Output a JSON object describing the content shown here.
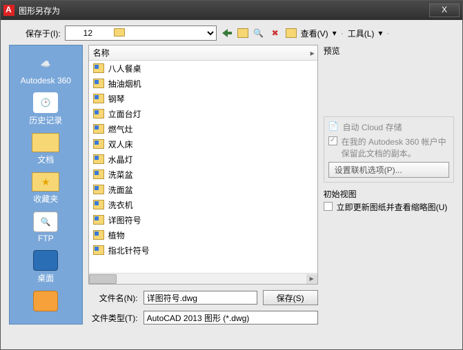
{
  "title": "图形另存为",
  "close_glyph": "X",
  "toprow": {
    "label": "保存于(I):",
    "folder": "12",
    "view_label": "查看(V)",
    "tools_label": "工具(L)"
  },
  "sidebar": [
    {
      "key": "autodesk360",
      "label": "Autodesk 360"
    },
    {
      "key": "history",
      "label": "历史记录"
    },
    {
      "key": "docs",
      "label": "文档"
    },
    {
      "key": "favorites",
      "label": "收藏夹"
    },
    {
      "key": "ftp",
      "label": "FTP"
    },
    {
      "key": "desktop",
      "label": "桌面"
    }
  ],
  "list": {
    "header_name": "名称",
    "files": [
      "八人餐桌",
      "抽油烟机",
      "钢琴",
      "立面台灯",
      "燃气灶",
      "双人床",
      "水晶灯",
      "洗菜盆",
      "洗面盆",
      "洗衣机",
      "详图符号",
      "植物",
      "指北针符号"
    ]
  },
  "right": {
    "preview_title": "预览",
    "cloud_auto": "自动 Cloud 存储",
    "cloud_keep": "在我的 Autodesk 360 帐户中保留此文档的副本。",
    "online_btn": "设置联机选项(P)...",
    "initview_title": "初始视图",
    "initview_chk": "立即更新图纸并查看缩略图(U)"
  },
  "bottom": {
    "filename_label": "文件名(N):",
    "filename_value": "详图符号.dwg",
    "filetype_label": "文件类型(T):",
    "filetype_value": "AutoCAD 2013 图形 (*.dwg)",
    "save_btn": "保存(S)"
  }
}
